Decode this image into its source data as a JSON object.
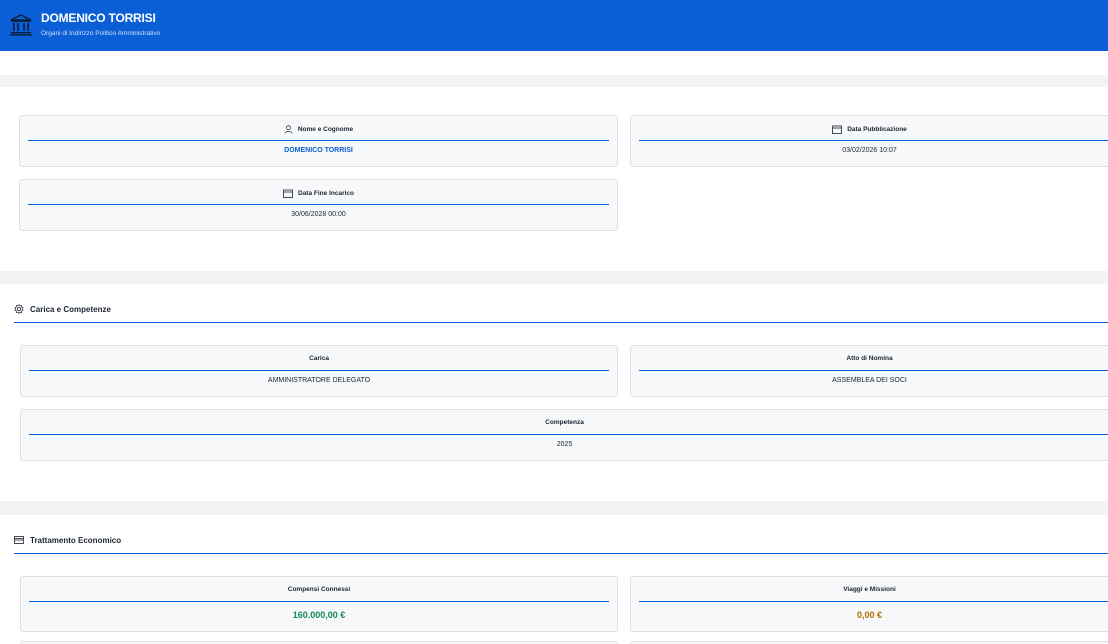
{
  "header": {
    "title": "DOMENICO TORRISI",
    "subtitle": "Organi di Indirizzo Politico Amministrativo",
    "icon": "bank-icon"
  },
  "info": {
    "name_label": "Nome e Cognome",
    "name_value": "DOMENICO TORRISI",
    "pub_label": "Data Pubblicazione",
    "pub_value": "03/02/2026 10:07",
    "end_label": "Data Fine Incarico",
    "end_value": "30/06/2028 00:00"
  },
  "carica_section": {
    "title": "Carica e Competenze",
    "icon": "gear-icon",
    "carica_label": "Carica",
    "carica_value": "AMMINISTRATORE DELEGATO",
    "atto_label": "Atto di Nomina",
    "atto_value": "ASSEMBLEA DEI SOCI",
    "competenza_label": "Competenza",
    "competenza_value": "2025"
  },
  "economic_section": {
    "title": "Trattamento Economico",
    "icon": "credit-card-icon",
    "compensi_label": "Compensi Connessi",
    "compensi_value": "160.000,00 €",
    "viaggi_label": "Viaggi e Missioni",
    "viaggi_value": "0,00 €"
  },
  "colors": {
    "accent": "#0b5fd6",
    "money_positive": "#0f8a4f",
    "money_neutral": "#b86a00"
  }
}
